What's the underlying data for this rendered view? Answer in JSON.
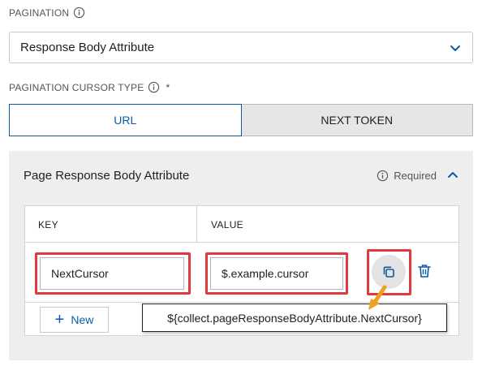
{
  "pagination": {
    "label": "PAGINATION",
    "selected": "Response Body Attribute"
  },
  "cursor_type": {
    "label": "PAGINATION CURSOR TYPE",
    "required_mark": "*",
    "options": [
      {
        "label": "URL",
        "active": true
      },
      {
        "label": "NEXT TOKEN",
        "active": false
      }
    ]
  },
  "panel": {
    "title": "Page Response Body Attribute",
    "required_label": "Required",
    "table": {
      "headers": {
        "key": "KEY",
        "value": "VALUE"
      },
      "rows": [
        {
          "key": "NextCursor",
          "value": "$.example.cursor"
        }
      ]
    },
    "new_button_label": "New"
  },
  "tooltip": {
    "text": "${collect.pageResponseBodyAttribute.NextCursor}"
  },
  "icons": {
    "info": "info-icon",
    "chevron_down": "chevron-down-icon",
    "chevron_up": "chevron-up-icon",
    "copy": "copy-icon",
    "trash": "trash-icon",
    "plus": "plus-icon"
  },
  "colors": {
    "accent": "#0a5ca8",
    "highlight": "#e0393e",
    "arrow": "#f0a020",
    "panel_bg": "#eeeeee"
  }
}
